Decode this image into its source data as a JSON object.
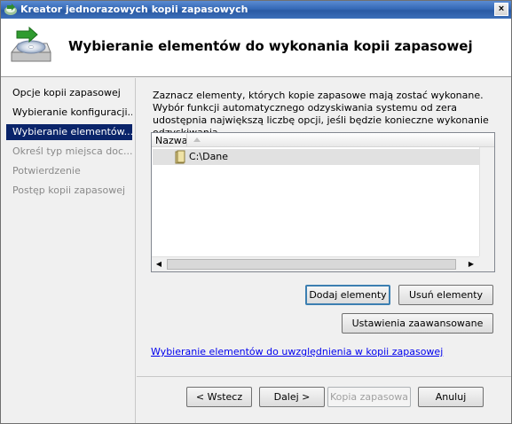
{
  "window": {
    "title": "Kreator jednorazowych kopii zapasowych",
    "close_glyph": "×"
  },
  "header": {
    "title": "Wybieranie elementów do wykonania kopii zapasowej"
  },
  "sidebar": {
    "items": [
      {
        "label": "Opcje kopii zapasowej",
        "state": "done"
      },
      {
        "label": "Wybieranie konfiguracji...",
        "state": "done"
      },
      {
        "label": "Wybieranie elementów...",
        "state": "active"
      },
      {
        "label": "Określ typ miejsca doc...",
        "state": "disabled"
      },
      {
        "label": "Potwierdzenie",
        "state": "disabled"
      },
      {
        "label": "Postęp kopii zapasowej",
        "state": "disabled"
      }
    ]
  },
  "main": {
    "description": "Zaznacz elementy, których kopie zapasowe mają zostać wykonane. Wybór funkcji automatycznego odzyskiwania systemu od zera udostępnia największą liczbę opcji, jeśli będzie konieczne wykonanie odzyskiwania.",
    "list": {
      "columns": [
        "Nazwa"
      ],
      "rows": [
        {
          "name": "C:\\Dane",
          "icon": "folder-icon"
        }
      ]
    },
    "buttons": {
      "add": "Dodaj elementy",
      "remove": "Usuń elementy",
      "advanced": "Ustawienia zaawansowane"
    },
    "link": "Wybieranie elementów do uwzględnienia w kopii zapasowej"
  },
  "footer": {
    "back": "< Wstecz",
    "next": "Dalej >",
    "backup": "Kopia zapasowa",
    "cancel": "Anuluj"
  },
  "colors": {
    "titlebar": "#3569b6",
    "selection": "#0a246a",
    "link": "#0000ee"
  }
}
